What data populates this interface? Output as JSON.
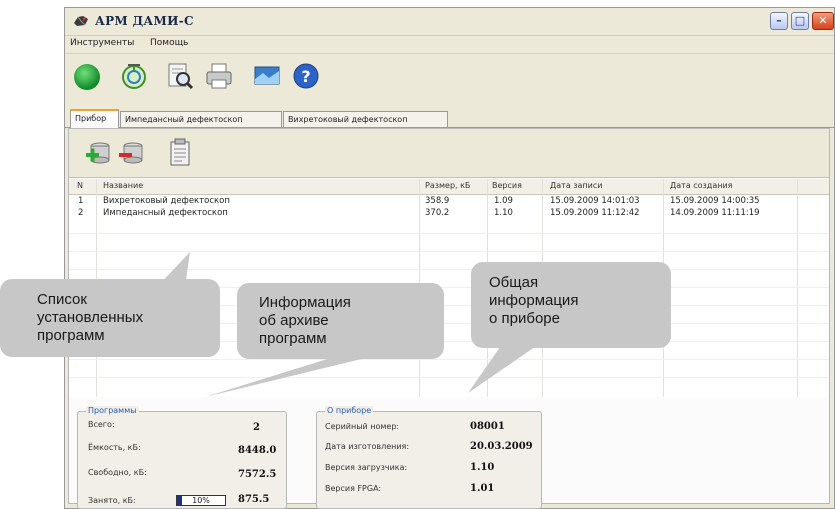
{
  "window": {
    "title": "АРМ ДАМИ-С"
  },
  "menu": [
    "Инструменты",
    "Помощь"
  ],
  "toolbar": {
    "icons": [
      "connect-icon",
      "sync-icon",
      "document-search-icon",
      "print-icon",
      "monitor-icon",
      "help-icon"
    ]
  },
  "tabs": [
    {
      "label": "Прибор",
      "active": true
    },
    {
      "label": "Импедансный дефектоскоп",
      "active": false
    },
    {
      "label": "Вихретоковый дефектоскоп",
      "active": false
    }
  ],
  "subtoolbar": {
    "icons": [
      "add-program-icon",
      "remove-program-icon",
      "archive-info-icon"
    ]
  },
  "table": {
    "columns": [
      "N",
      "Название",
      "Размер, кБ",
      "Версия",
      "Дата записи",
      "Дата создания"
    ],
    "rows": [
      [
        "1",
        "Вихретоковый дефектоскоп",
        "358.9",
        "1.09",
        "15.09.2009 14:01:03",
        "15.09.2009 14:00:35"
      ],
      [
        "2",
        "Импедансный дефектоскоп",
        "370.2",
        "1.10",
        "15.09.2009 11:12:42",
        "14.09.2009 11:11:19"
      ]
    ]
  },
  "programs": {
    "title": "Программы",
    "total_label": "Всего:",
    "total": "2",
    "capacity_label": "Ёмкость, кБ:",
    "capacity": "8448.0",
    "free_label": "Свободно, кБ:",
    "free": "7572.5",
    "used_label": "Занято, кБ:",
    "used_percent_text": "10%",
    "used_fraction": 0.1,
    "used": "875.5"
  },
  "device": {
    "title": "О приборе",
    "serial_label": "Серийный номер:",
    "serial": "08001",
    "date_label": "Дата изготовления:",
    "date": "20.03.2009",
    "loader_label": "Версия загрузчика:",
    "loader": "1.10",
    "fpga_label": "Версия FPGA:",
    "fpga": "1.01"
  },
  "callouts": {
    "programs_list": "Список\nустановленных\nпрограмм",
    "archive_info": "Информация\nоб архиве\nпрограмм",
    "device_info": "Общая\nинформация\nо приборе"
  },
  "colors": {
    "window_bg": "#ece9d8",
    "accent": "#2a5db0",
    "callout_bg": "#c7c7c7",
    "progress": "#1f2f86"
  }
}
